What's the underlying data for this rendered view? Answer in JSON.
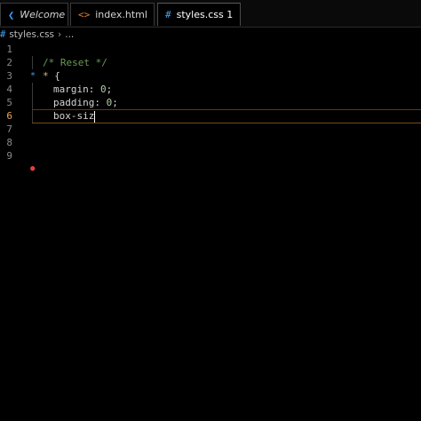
{
  "tabs": [
    {
      "label": "Welcome",
      "icon": "vscode-icon"
    },
    {
      "label": "index.html",
      "icon": "html-icon"
    },
    {
      "label": "styles.css 1",
      "icon": "css-icon"
    }
  ],
  "breadcrumb": {
    "file": "styles.css",
    "rest": "..."
  },
  "editor": {
    "line_numbers": [
      "1",
      "2",
      "3",
      "4",
      "5",
      "6",
      "7",
      "8",
      "9"
    ],
    "lines": {
      "l2": "/* Reset */",
      "l3_selector": "*",
      "l3_brace": " {",
      "l4_prop": "margin: ",
      "l4_val": "0",
      "l4_end": ";",
      "l5_prop": "padding: ",
      "l5_val": "0",
      "l5_end": ";",
      "l6": "box-siz"
    }
  },
  "colors": {
    "accent": "#e37933",
    "css_icon": "#42a5f5",
    "comment": "#6a9955",
    "selector": "#d7ba7d",
    "number": "#b5cea8"
  }
}
